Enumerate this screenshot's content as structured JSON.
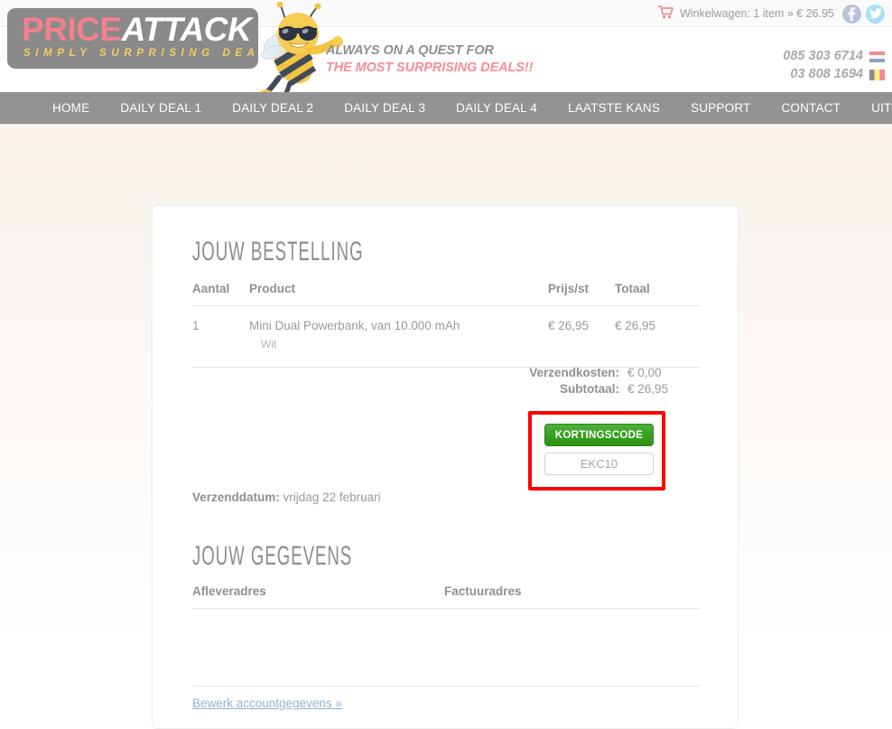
{
  "topbar": {
    "cart_icon": "shopping-cart-icon",
    "cart_text": "Winkelwagen: 1 item » € 26.95",
    "social": [
      {
        "name": "facebook-icon",
        "label": "f",
        "color": "#b9c3d6"
      },
      {
        "name": "twitter-icon",
        "label": "t",
        "color": "#a8e0f5"
      }
    ]
  },
  "header": {
    "logo": {
      "part1": "PRICE",
      "part2": "ATTACK",
      "tagline": "SIMPLY SURPRISING DEALS",
      "box_color": "#8a8a8a",
      "part1_color": "#f2808c",
      "part2_color": "#ffffff",
      "tagline_color": "#f2cf5e"
    },
    "mascot": "bee-mascot-icon",
    "tagline_line1": "ALWAYS ON A QUEST FOR",
    "tagline_line2": "THE MOST SURPRISING DEALS!!",
    "tagline_line1_color": "#8f8f8f",
    "tagline_line2_color": "#f58d96",
    "phones": [
      {
        "number": "085 303 6714",
        "flag": "netherlands-flag-icon"
      },
      {
        "number": "03 808 1694",
        "flag": "belgium-flag-icon"
      }
    ]
  },
  "nav": {
    "background": "#939393",
    "items": [
      {
        "label": "HOME"
      },
      {
        "label": "DAILY DEAL 1"
      },
      {
        "label": "DAILY DEAL 2"
      },
      {
        "label": "DAILY DEAL 3"
      },
      {
        "label": "DAILY DEAL 4"
      },
      {
        "label": "LAATSTE KANS"
      },
      {
        "label": "SUPPORT"
      },
      {
        "label": "CONTACT"
      },
      {
        "label": "UITLOGGEN"
      }
    ]
  },
  "order": {
    "title": "JOUW BESTELLING",
    "columns": {
      "aantal": "Aantal",
      "product": "Product",
      "prijs": "Prijs/st",
      "totaal": "Totaal"
    },
    "rows": [
      {
        "aantal": "1",
        "product": "Mini Dual Powerbank, van 10.000 mAh",
        "variant": "Wit",
        "prijs": "€ 26,95",
        "totaal": "€ 26,95"
      }
    ],
    "totals": [
      {
        "label": "Verzendkosten:",
        "value": "€ 0,00"
      },
      {
        "label": "Subtotaal:",
        "value": "€ 26,95"
      }
    ]
  },
  "coupon": {
    "button_label": "KORTINGSCODE",
    "input_value": "EKC10",
    "input_placeholder": "EKC10",
    "button_color": "#37a11f",
    "highlight_color": "#ff0000"
  },
  "shipping": {
    "label": "Verzenddatum:",
    "value": "vrijdag 22 februari"
  },
  "account": {
    "title": "JOUW GEGEVENS",
    "columns": {
      "delivery": "Afleveradres",
      "invoice": "Factuuradres"
    },
    "delivery_address": "",
    "invoice_address": "",
    "edit_link": "Bewerk accountgegevens »"
  }
}
